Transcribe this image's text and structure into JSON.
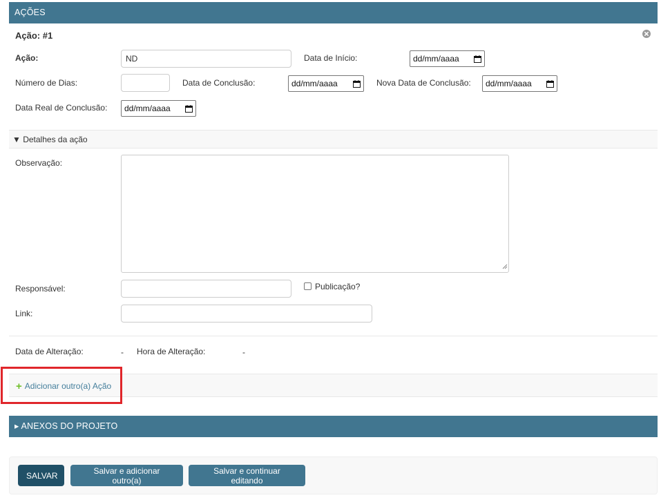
{
  "section_title": "AÇÕES",
  "inline_title": "Ação: #1",
  "fields": {
    "acao_label": "Ação:",
    "acao_value": "ND",
    "data_inicio_label": "Data de Início:",
    "data_inicio_value": "dd/mm/aaaa",
    "numero_dias_label": "Número de Dias:",
    "numero_dias_value": "",
    "data_conclusao_label": "Data de Conclusão:",
    "data_conclusao_value": "dd/mm/aaaa",
    "nova_data_conclusao_label": "Nova Data de Conclusão:",
    "nova_data_conclusao_value": "dd/mm/aaaa",
    "data_real_conclusao_label": "Data Real de Conclusão:",
    "data_real_conclusao_value": "dd/mm/aaaa"
  },
  "details": {
    "toggle_label": "▼ Detalhes da ação",
    "observacao_label": "Observação:",
    "responsavel_label": "Responsável:",
    "publicacao_label": "Publicação?",
    "link_label": "Link:"
  },
  "meta": {
    "data_alteracao_label": "Data de Alteração:",
    "data_alteracao_value": "-",
    "hora_alteracao_label": "Hora de Alteração:",
    "hora_alteracao_value": "-"
  },
  "add_another": "Adicionar outro(a) Ação",
  "attachments_title": "▸ ANEXOS DO PROJETO",
  "buttons": {
    "save": "SALVAR",
    "save_add": "Salvar e adicionar outro(a)",
    "save_continue": "Salvar e continuar editando"
  },
  "icons": {
    "close": "close-circle-icon",
    "calendar": "calendar-icon",
    "add": "plus-icon"
  },
  "colors": {
    "header": "#417690",
    "primary_button": "#205067",
    "link": "#447e9b",
    "add_plus": "#70bf2b",
    "highlight": "#e0262b"
  }
}
